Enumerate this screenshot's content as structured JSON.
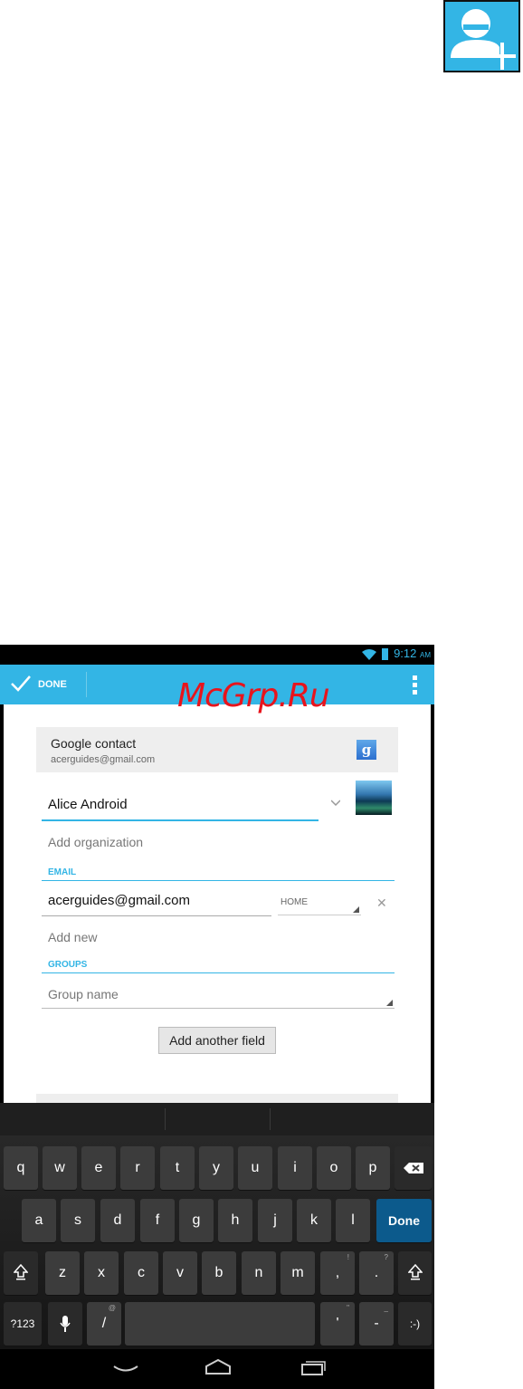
{
  "status_bar": {
    "time": "9:12",
    "ampm": "AM"
  },
  "action_bar": {
    "done_label": "DONE"
  },
  "watermark": "McGrp.Ru",
  "account": {
    "type": "Google contact",
    "email": "acerguides@gmail.com",
    "icon_letter": "g"
  },
  "form": {
    "name_value": "Alice Android",
    "add_organization": "Add organization",
    "email_section": "EMAIL",
    "email_value": "acerguides@gmail.com",
    "email_type": "HOME",
    "remove_symbol": "✕",
    "add_new": "Add new",
    "groups_section": "GROUPS",
    "group_placeholder": "Group name",
    "add_field_button": "Add another field"
  },
  "keyboard": {
    "row1": [
      "q",
      "w",
      "e",
      "r",
      "t",
      "y",
      "u",
      "i",
      "o",
      "p"
    ],
    "row2": [
      "a",
      "s",
      "d",
      "f",
      "g",
      "h",
      "j",
      "k",
      "l"
    ],
    "row3": [
      "z",
      "x",
      "c",
      "v",
      "b",
      "n",
      "m",
      ",",
      "."
    ],
    "row3_sup": [
      "",
      "",
      "",
      "",
      "",
      "",
      "",
      "!",
      "?"
    ],
    "done_label": "Done",
    "symbols_label": "?123",
    "slash": "/",
    "slash_sup": "@",
    "apostrophe": "'",
    "apostrophe_sup": "\"",
    "dash": "-",
    "dash_sup": "_",
    "smiley": ":-)"
  }
}
